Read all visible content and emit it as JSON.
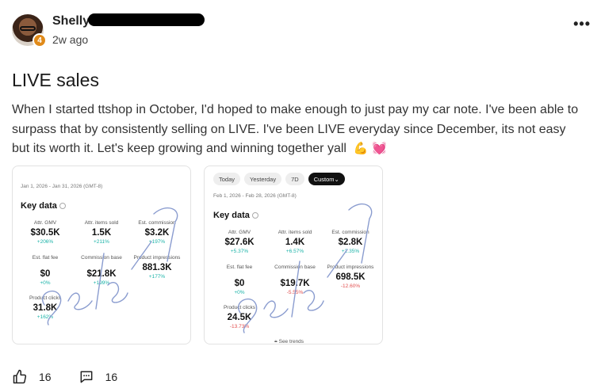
{
  "post": {
    "author": {
      "name": "Shelly",
      "level_badge": "4",
      "time": "2w ago"
    },
    "more_icon": "more-horizontal-icon",
    "title": "LIVE sales",
    "body": "When I started ttshop in October, I'd hoped to make enough to just pay my car note. I've been able to surpass that by consistently selling on LIVE. I've been LIVE everyday since December, its not easy but its worth it. Let's keep growing and winning together yall",
    "emojis": [
      "💪",
      "💓"
    ],
    "actions": {
      "like_count": "16",
      "comment_count": "16"
    }
  },
  "cards": [
    {
      "range": "Jan 1, 2026 - Jan 31, 2026 (GMT-8)",
      "key_data_title": "Key data",
      "metrics": [
        {
          "label": "Attr. GMV",
          "value": "$30.5K",
          "change": "+206%"
        },
        {
          "label": "Attr. items sold",
          "value": "1.5K",
          "change": "+211%"
        },
        {
          "label": "Est. commission",
          "value": "$3.2K",
          "change": "+197%"
        },
        {
          "label": "Est. flat fee",
          "value": "$0",
          "change": "+0%"
        },
        {
          "label": "Commission base",
          "value": "$21.8K",
          "change": "+199%"
        },
        {
          "label": "Product impressions",
          "value": "881.3K",
          "change": "+177%"
        },
        {
          "label": "Product clicks",
          "value": "31.8K",
          "change": "+162%"
        }
      ]
    },
    {
      "chips": [
        "Today",
        "Yesterday",
        "7D",
        "Custom⌄"
      ],
      "range": "Feb 1, 2026 - Feb 28, 2026 (GMT-8)",
      "key_data_title": "Key data",
      "metrics": [
        {
          "label": "Attr. GMV",
          "value": "$27.6K",
          "change": "+5.37%"
        },
        {
          "label": "Attr. items sold",
          "value": "1.4K",
          "change": "+6.57%"
        },
        {
          "label": "Est. commission",
          "value": "$2.8K",
          "change": "+2.35%"
        },
        {
          "label": "Est. flat fee",
          "value": "$0",
          "change": "+0%"
        },
        {
          "label": "Commission base",
          "value": "$19.7K",
          "change": "-5.55%"
        },
        {
          "label": "Product impressions",
          "value": "698.5K",
          "change": "-12.60%"
        },
        {
          "label": "Product clicks",
          "value": "24.5K",
          "change": "-13.73%"
        }
      ],
      "see_trends": "See trends"
    }
  ],
  "colors": {
    "positive": "#1bb3a8",
    "negative": "#e24e4e",
    "badge": "#e08a1a",
    "signature": "#8a9ccf"
  }
}
